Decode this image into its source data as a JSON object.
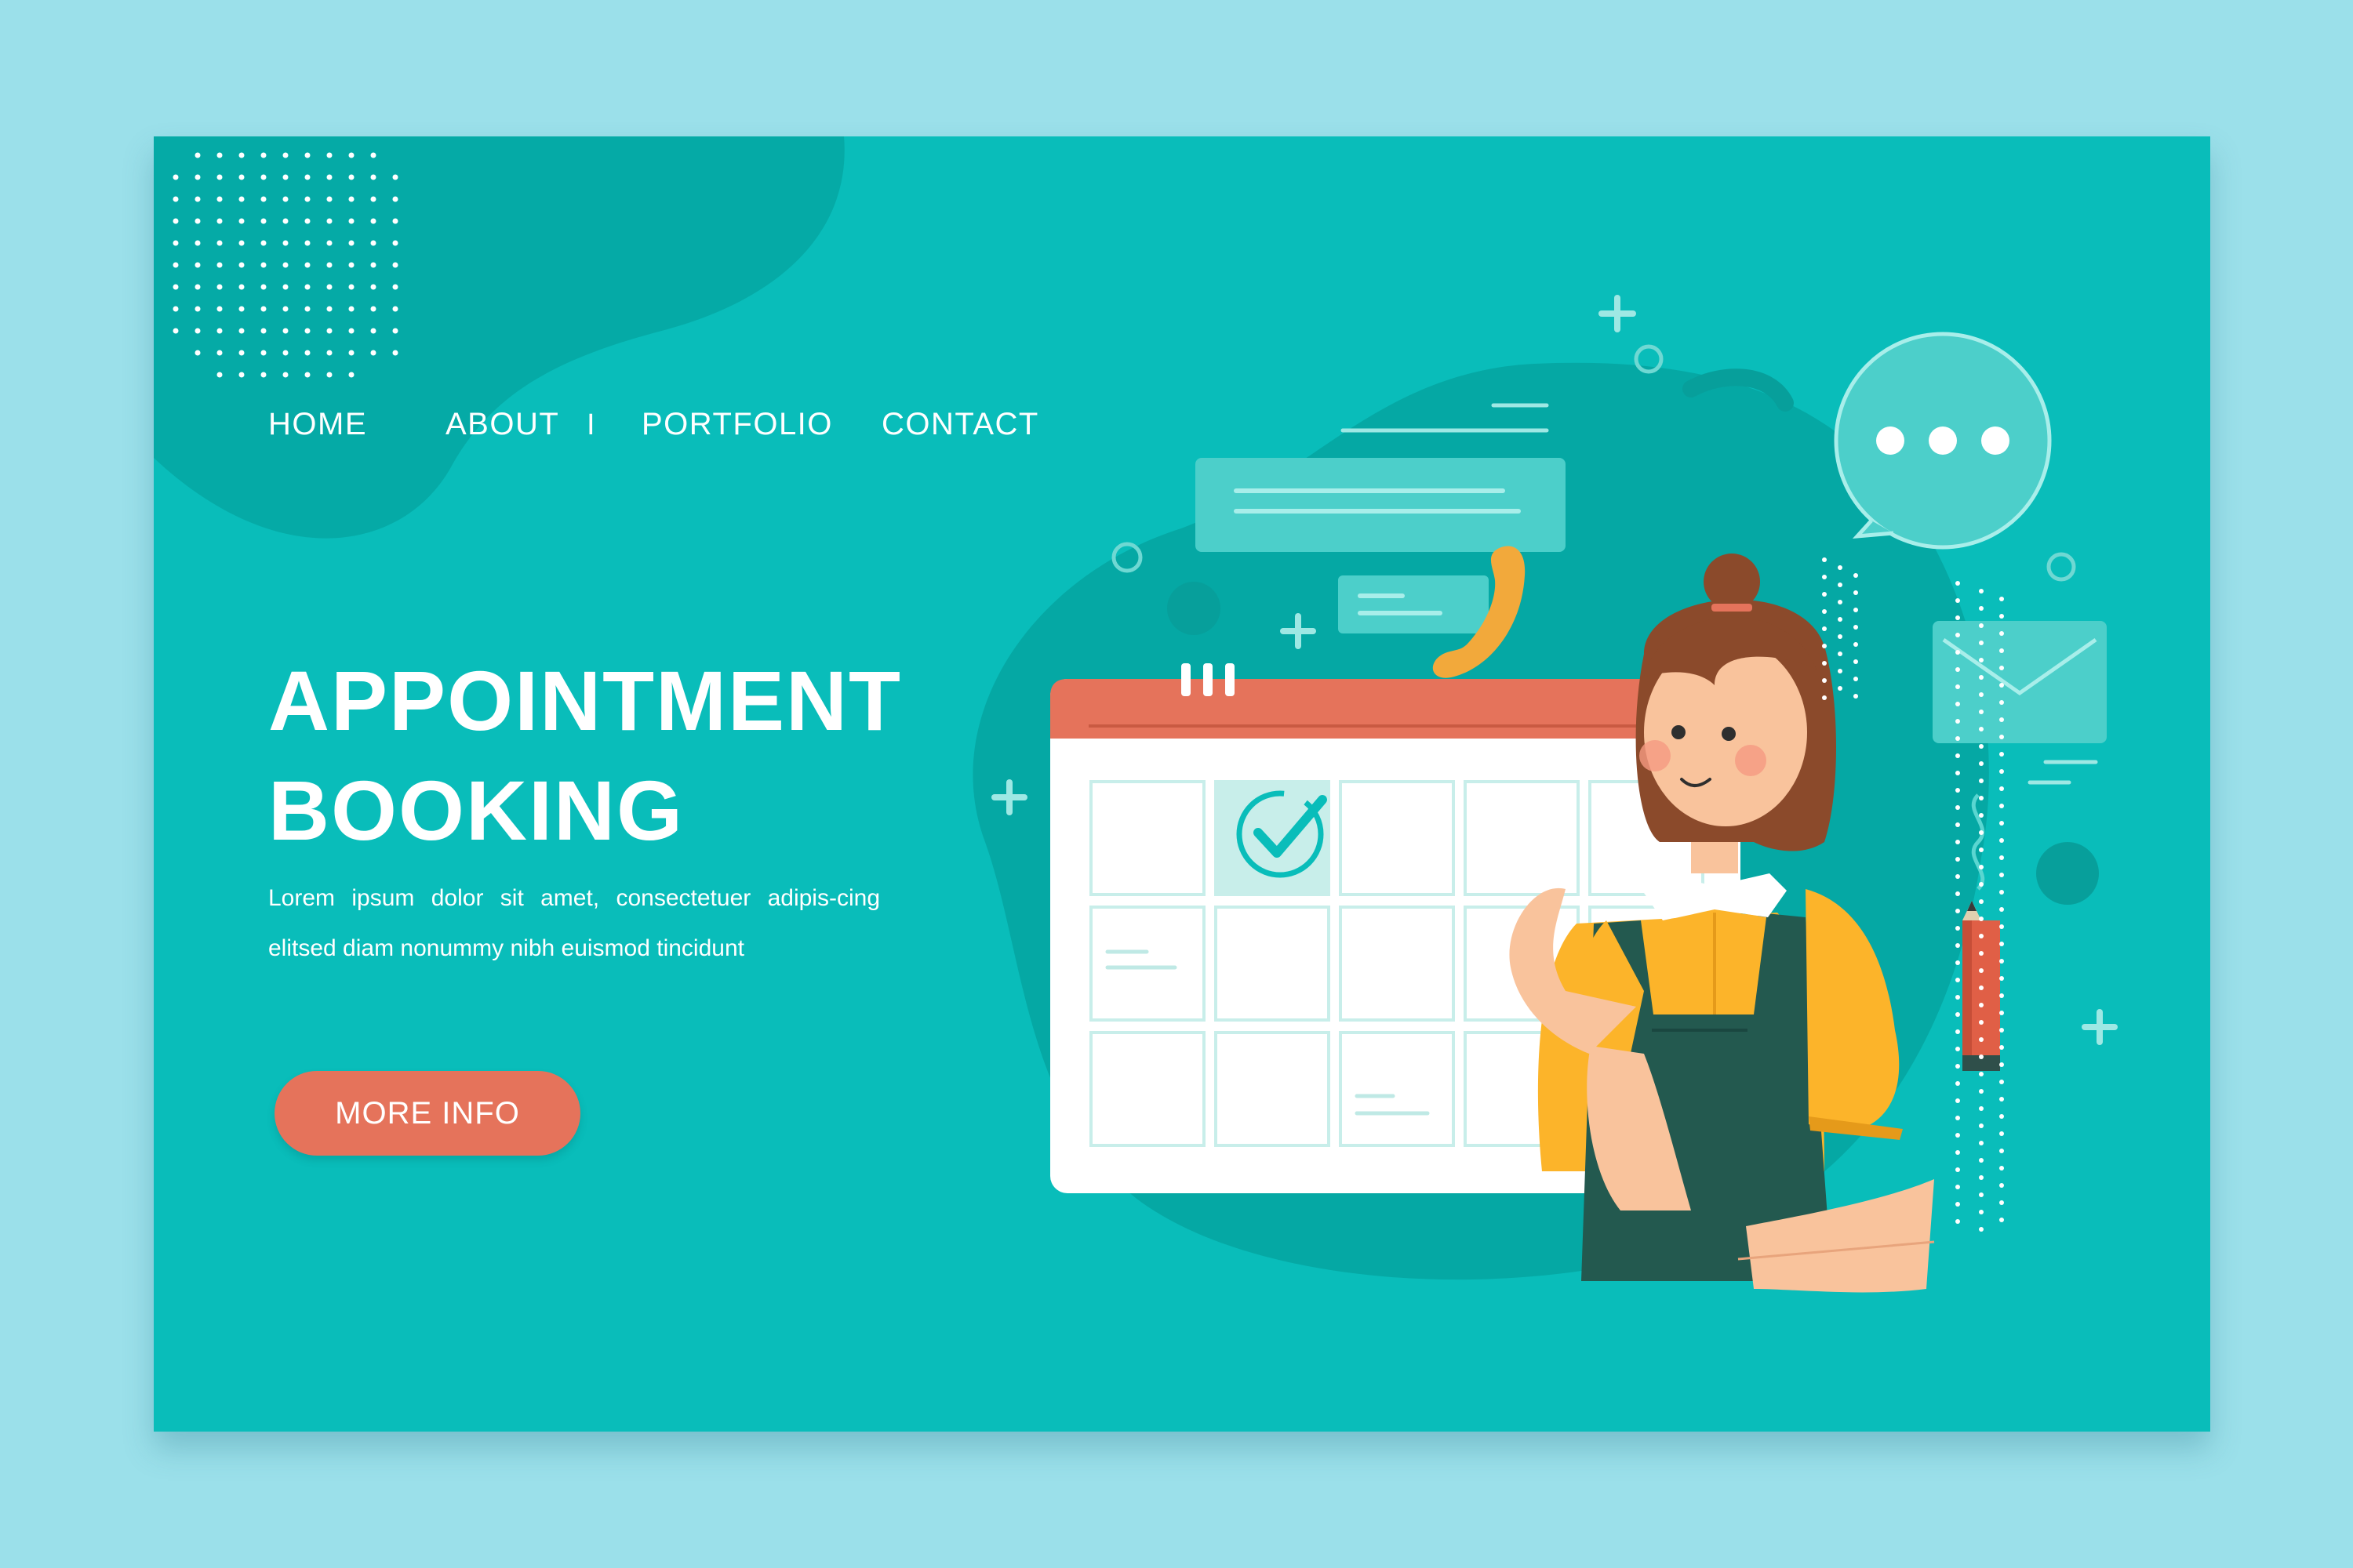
{
  "nav": {
    "items": [
      {
        "label": "HOME"
      },
      {
        "label": "ABOUT"
      },
      {
        "label": "PORTFOLIO"
      },
      {
        "label": "CONTACT"
      }
    ],
    "separator": "I"
  },
  "hero": {
    "title_line1": "APPOINTMENT",
    "title_line2": "BOOKING",
    "description": "Lorem ipsum dolor sit amet, consectetuer adipis-cing elitsed diam nonummy nibh euismod tincidunt",
    "button_label": "MORE INFO"
  },
  "icons": [
    "calendar-icon",
    "check-icon",
    "chat-bubble-icon",
    "envelope-icon",
    "phone-icon",
    "pencil-icon"
  ],
  "colors": {
    "page_background": "#9be0ea",
    "card_background": "#09bdba",
    "accent": "#e5735b",
    "shirt": "#fcb42a",
    "apron": "#23594f"
  }
}
